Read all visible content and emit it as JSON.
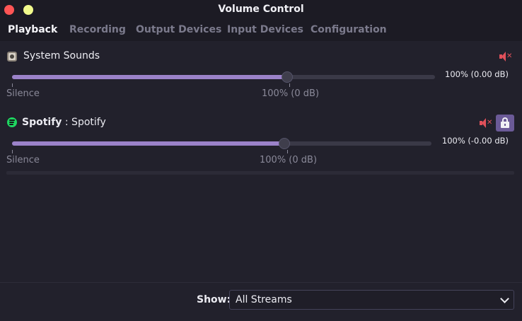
{
  "window": {
    "title": "Volume Control"
  },
  "tabs": [
    {
      "label": "Playback",
      "active": true
    },
    {
      "label": "Recording",
      "active": false
    },
    {
      "label": "Output Devices",
      "active": false
    },
    {
      "label": "Input Devices",
      "active": false
    },
    {
      "label": "Configuration",
      "active": false
    }
  ],
  "streams": [
    {
      "name": "System Sounds",
      "app": "",
      "icon": "speaker-device-icon",
      "volume_text": "100% (0.00 dB)",
      "volume_fraction": 0.65,
      "muted_icon": "muted-speaker-icon",
      "silence_label": "Silence",
      "mark_label": "100% (0 dB)",
      "has_lock": false
    },
    {
      "name": "Spotify",
      "app": ": Spotify",
      "icon": "spotify-icon",
      "volume_text": "100% (-0.00 dB)",
      "volume_fraction": 0.65,
      "muted_icon": "muted-speaker-icon",
      "silence_label": "Silence",
      "mark_label": "100% (0 dB)",
      "has_lock": true
    }
  ],
  "footer": {
    "show_label": "Show:",
    "show_value": "All Streams"
  },
  "colors": {
    "accent": "#9b82c9",
    "mute": "#e0505a",
    "lock_button": "#6b5a97",
    "background": "#22212c"
  }
}
